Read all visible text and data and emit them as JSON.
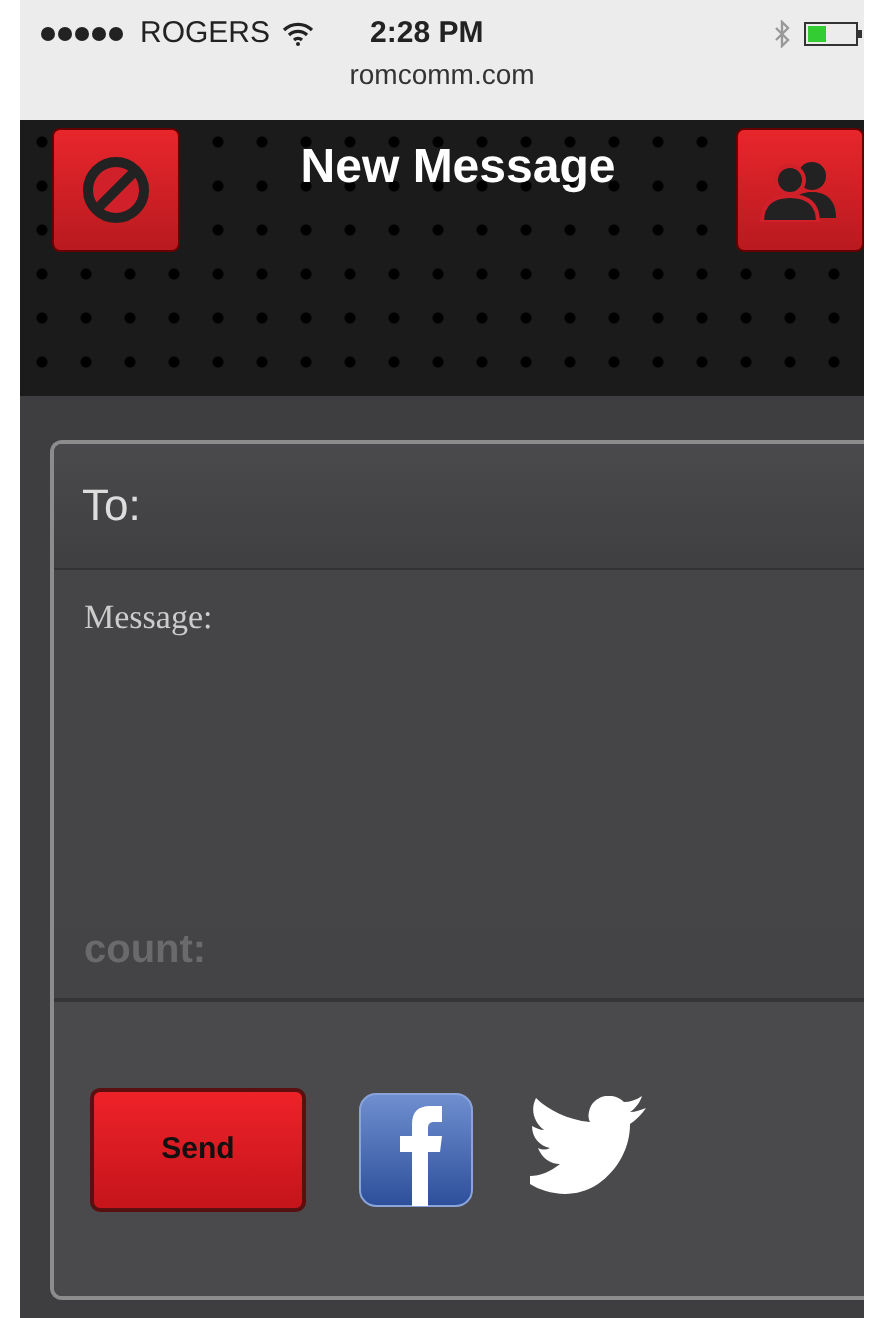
{
  "status_bar": {
    "carrier": "ROGERS",
    "time": "2:28 PM",
    "url": "romcomm.com"
  },
  "header": {
    "title": "New Message"
  },
  "form": {
    "to_placeholder": "To:",
    "message_placeholder": "Message:",
    "count_label": "count:"
  },
  "send_button": "Send"
}
